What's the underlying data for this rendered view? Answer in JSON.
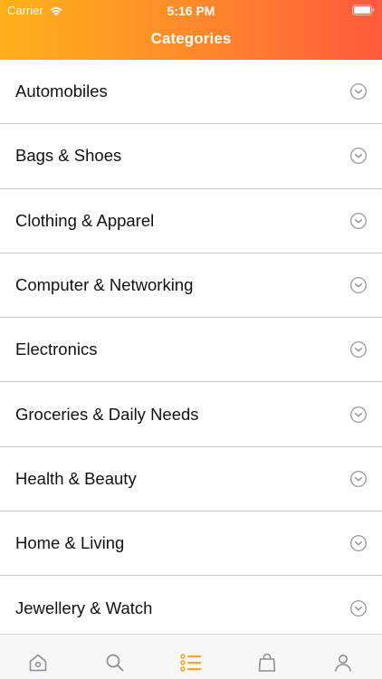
{
  "status_bar": {
    "carrier": "Carrier",
    "time": "5:16 PM"
  },
  "nav": {
    "title": "Categories"
  },
  "categories": [
    {
      "label": "Automobiles"
    },
    {
      "label": "Bags & Shoes"
    },
    {
      "label": "Clothing & Apparel"
    },
    {
      "label": "Computer & Networking"
    },
    {
      "label": "Electronics"
    },
    {
      "label": "Groceries & Daily Needs"
    },
    {
      "label": "Health & Beauty"
    },
    {
      "label": "Home & Living"
    },
    {
      "label": "Jewellery & Watch"
    }
  ],
  "tabbar": {
    "tabs": [
      {
        "icon": "home-icon",
        "active": false
      },
      {
        "icon": "search-icon",
        "active": false
      },
      {
        "icon": "categories-list-icon",
        "active": true
      },
      {
        "icon": "shopping-bag-icon",
        "active": false
      },
      {
        "icon": "profile-icon",
        "active": false
      }
    ],
    "active_color": "#f5a623",
    "inactive_color": "#8e8e93"
  },
  "colors": {
    "header_gradient_start": "#ffb01a",
    "header_gradient_end": "#ff5a3c",
    "separator": "#c6c6c8",
    "chevron": "#8e8e93"
  }
}
